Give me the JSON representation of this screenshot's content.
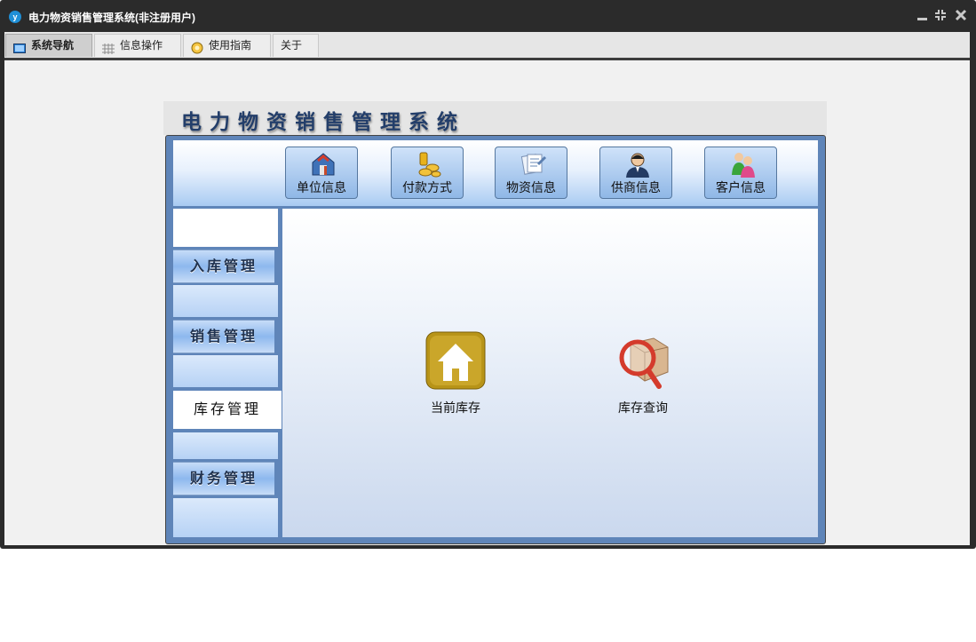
{
  "window": {
    "title": "电力物资销售管理系统(非注册用户)",
    "logo_text": "y"
  },
  "tabs": [
    {
      "label": "系统导航",
      "active": true
    },
    {
      "label": "信息操作",
      "active": false
    },
    {
      "label": "使用指南",
      "active": false
    },
    {
      "label": "关于",
      "active": false
    }
  ],
  "panel": {
    "title": "电力物资销售管理系统"
  },
  "toolbar": [
    {
      "label": "单位信息"
    },
    {
      "label": "付款方式"
    },
    {
      "label": "物资信息"
    },
    {
      "label": "供商信息"
    },
    {
      "label": "客户信息"
    }
  ],
  "sidebar": [
    {
      "label": "入库管理"
    },
    {
      "label": "销售管理"
    },
    {
      "label": "库存管理"
    },
    {
      "label": "财务管理"
    }
  ],
  "sidebar_active": "库存管理",
  "features": [
    {
      "label": "当前库存"
    },
    {
      "label": "库存查询"
    }
  ]
}
